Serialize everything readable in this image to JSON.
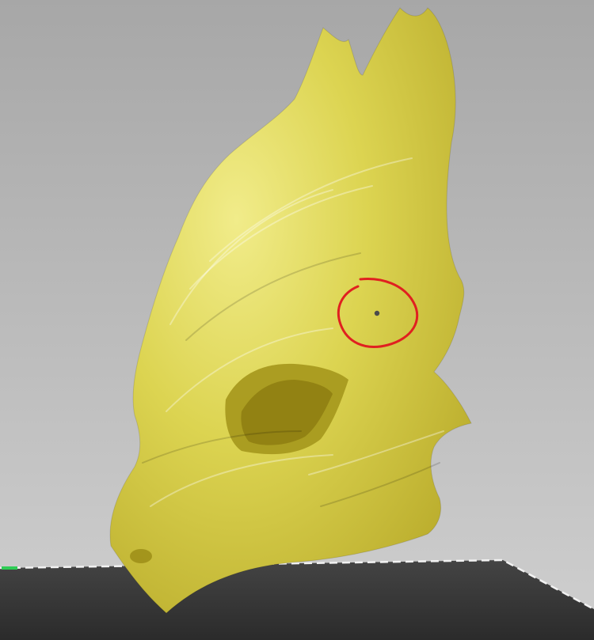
{
  "scene": {
    "background_top": "#a7a7a7",
    "background_bottom": "#cfcfcf",
    "model_color": "#dcd451",
    "model_shadow": "#b8aa2a",
    "model_highlight": "#f1ec8a",
    "bed_color": "#3b3b3b",
    "bed_edge_color": "#f2f2f2",
    "axis_color": "#2ecc55",
    "annotation_color": "#e02020"
  },
  "icons": {
    "model": "mask-model-icon",
    "annotation": "red-circle-marker-icon"
  }
}
